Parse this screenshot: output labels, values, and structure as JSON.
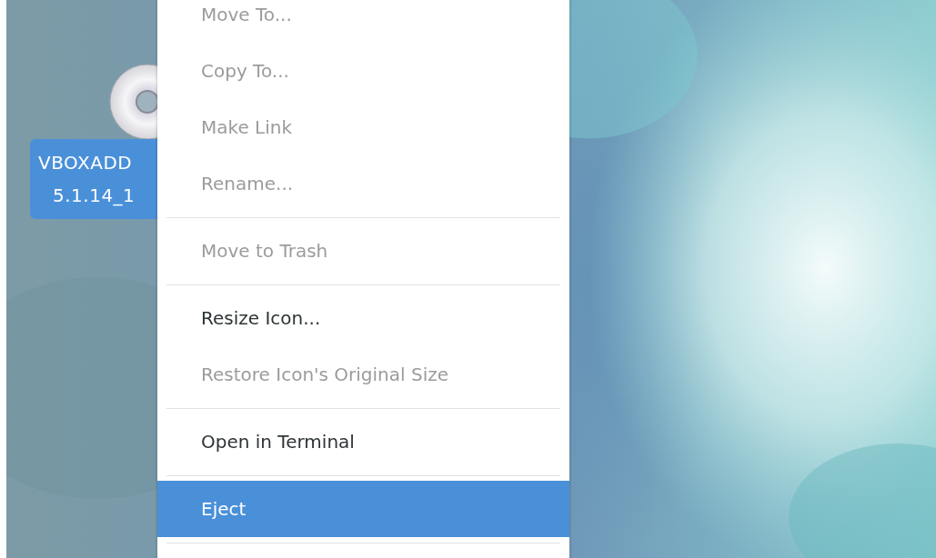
{
  "desktop_icon": {
    "label_lines": [
      "VBOXADD",
      "5.1.14_1"
    ],
    "selected": true
  },
  "context_menu": {
    "items": [
      {
        "kind": "item",
        "label": "Move To...",
        "disabled": true,
        "selected": false
      },
      {
        "kind": "item",
        "label": "Copy To...",
        "disabled": true,
        "selected": false
      },
      {
        "kind": "item",
        "label": "Make Link",
        "disabled": true,
        "selected": false
      },
      {
        "kind": "item",
        "label": "Rename...",
        "disabled": true,
        "selected": false
      },
      {
        "kind": "separator"
      },
      {
        "kind": "item",
        "label": "Move to Trash",
        "disabled": true,
        "selected": false
      },
      {
        "kind": "separator"
      },
      {
        "kind": "item",
        "label": "Resize Icon...",
        "disabled": false,
        "selected": false
      },
      {
        "kind": "item",
        "label": "Restore Icon's Original Size",
        "disabled": true,
        "selected": false
      },
      {
        "kind": "separator"
      },
      {
        "kind": "item",
        "label": "Open in Terminal",
        "disabled": false,
        "selected": false
      },
      {
        "kind": "separator"
      },
      {
        "kind": "item",
        "label": "Eject",
        "disabled": false,
        "selected": true
      },
      {
        "kind": "separator"
      }
    ]
  }
}
